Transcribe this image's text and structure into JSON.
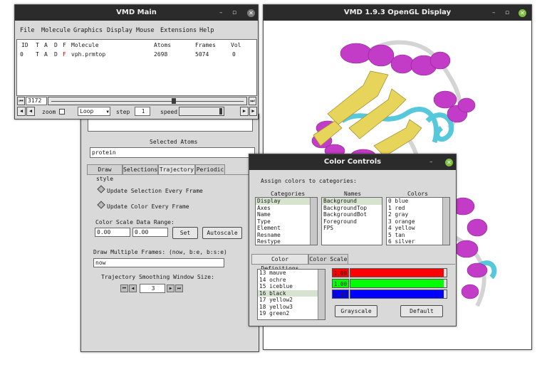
{
  "vmd_main": {
    "title": "VMD Main",
    "minimize": "–",
    "maximize": "▫",
    "close": "✕",
    "menu": [
      "File",
      "Molecule",
      "Graphics",
      "Display",
      "Mouse",
      "Extensions",
      "Help"
    ],
    "columns": {
      "id": "ID",
      "t": "T",
      "a": "A",
      "d": "D",
      "f": "F",
      "molecule": "Molecule",
      "atoms": "Atoms",
      "frames": "Frames",
      "vol": "Vol"
    },
    "molecule_row": {
      "id": "0",
      "t": "T",
      "a": "A",
      "d": "D",
      "f": "F",
      "molecule": "vph.prmtop",
      "atoms": "2698",
      "frames": "5074",
      "vol": "0"
    },
    "frame_value": "3172",
    "zoom_label": "zoom",
    "loop_mode": "Loop",
    "step_label": "step",
    "step_value": "1",
    "speed_label": "speed",
    "frame_progress": 0.625
  },
  "graphical_rep": {
    "selected_atoms_label": "Selected Atoms",
    "selection_text": "protein",
    "tabs": [
      "Draw style",
      "Selections",
      "Trajectory",
      "Periodic"
    ],
    "active_tab": 2,
    "update_selection": "Update Selection Every Frame",
    "update_color": "Update Color Every Frame",
    "color_scale_label": "Color Scale Data Range:",
    "range_min": "0.00",
    "range_max": "0.00",
    "set_button": "Set",
    "autoscale_button": "Autoscale",
    "draw_frames_label": "Draw Multiple Frames: (now, b:e, b:s:e)",
    "draw_frames_value": "now",
    "smoothing_label": "Trajectory Smoothing Window Size:",
    "smoothing_value": "3"
  },
  "opengl": {
    "title": "VMD 1.9.3 OpenGL Display",
    "colors": {
      "helix": "#c33cc8",
      "sheet": "#e7d45a",
      "turn": "#56c8dc",
      "coil": "#d0d0d0",
      "close": "#7fbf3f"
    }
  },
  "color_controls": {
    "title": "Color Controls",
    "assign_label": "Assign colors to categories:",
    "categories_header": "Categories",
    "names_header": "Names",
    "colors_header": "Colors",
    "categories": [
      "Display",
      "Axes",
      "Name",
      "Type",
      "Element",
      "Resname",
      "Restype"
    ],
    "names": [
      "Background",
      "BackgroundTop",
      "BackgroundBot",
      "Foreground",
      "FPS"
    ],
    "colors": [
      "0 blue",
      "1 red",
      "2 gray",
      "3 orange",
      "4 yellow",
      "5 tan",
      "6 silver"
    ],
    "tabs": [
      "Color Definitions",
      "Color Scale"
    ],
    "color_defs": [
      "13 mauve",
      "14 ochre",
      "15 iceblue",
      "16 black",
      "17 yellow2",
      "18 yellow3",
      "19 green2"
    ],
    "rgb": [
      {
        "value": "1.00",
        "fill": 0.97,
        "color": "#ff0000"
      },
      {
        "value": "1.00",
        "fill": 0.97,
        "color": "#00ff00"
      },
      {
        "value": "1.00",
        "fill": 0.97,
        "color": "#0000ff"
      }
    ],
    "grayscale_button": "Grayscale",
    "default_button": "Default"
  }
}
